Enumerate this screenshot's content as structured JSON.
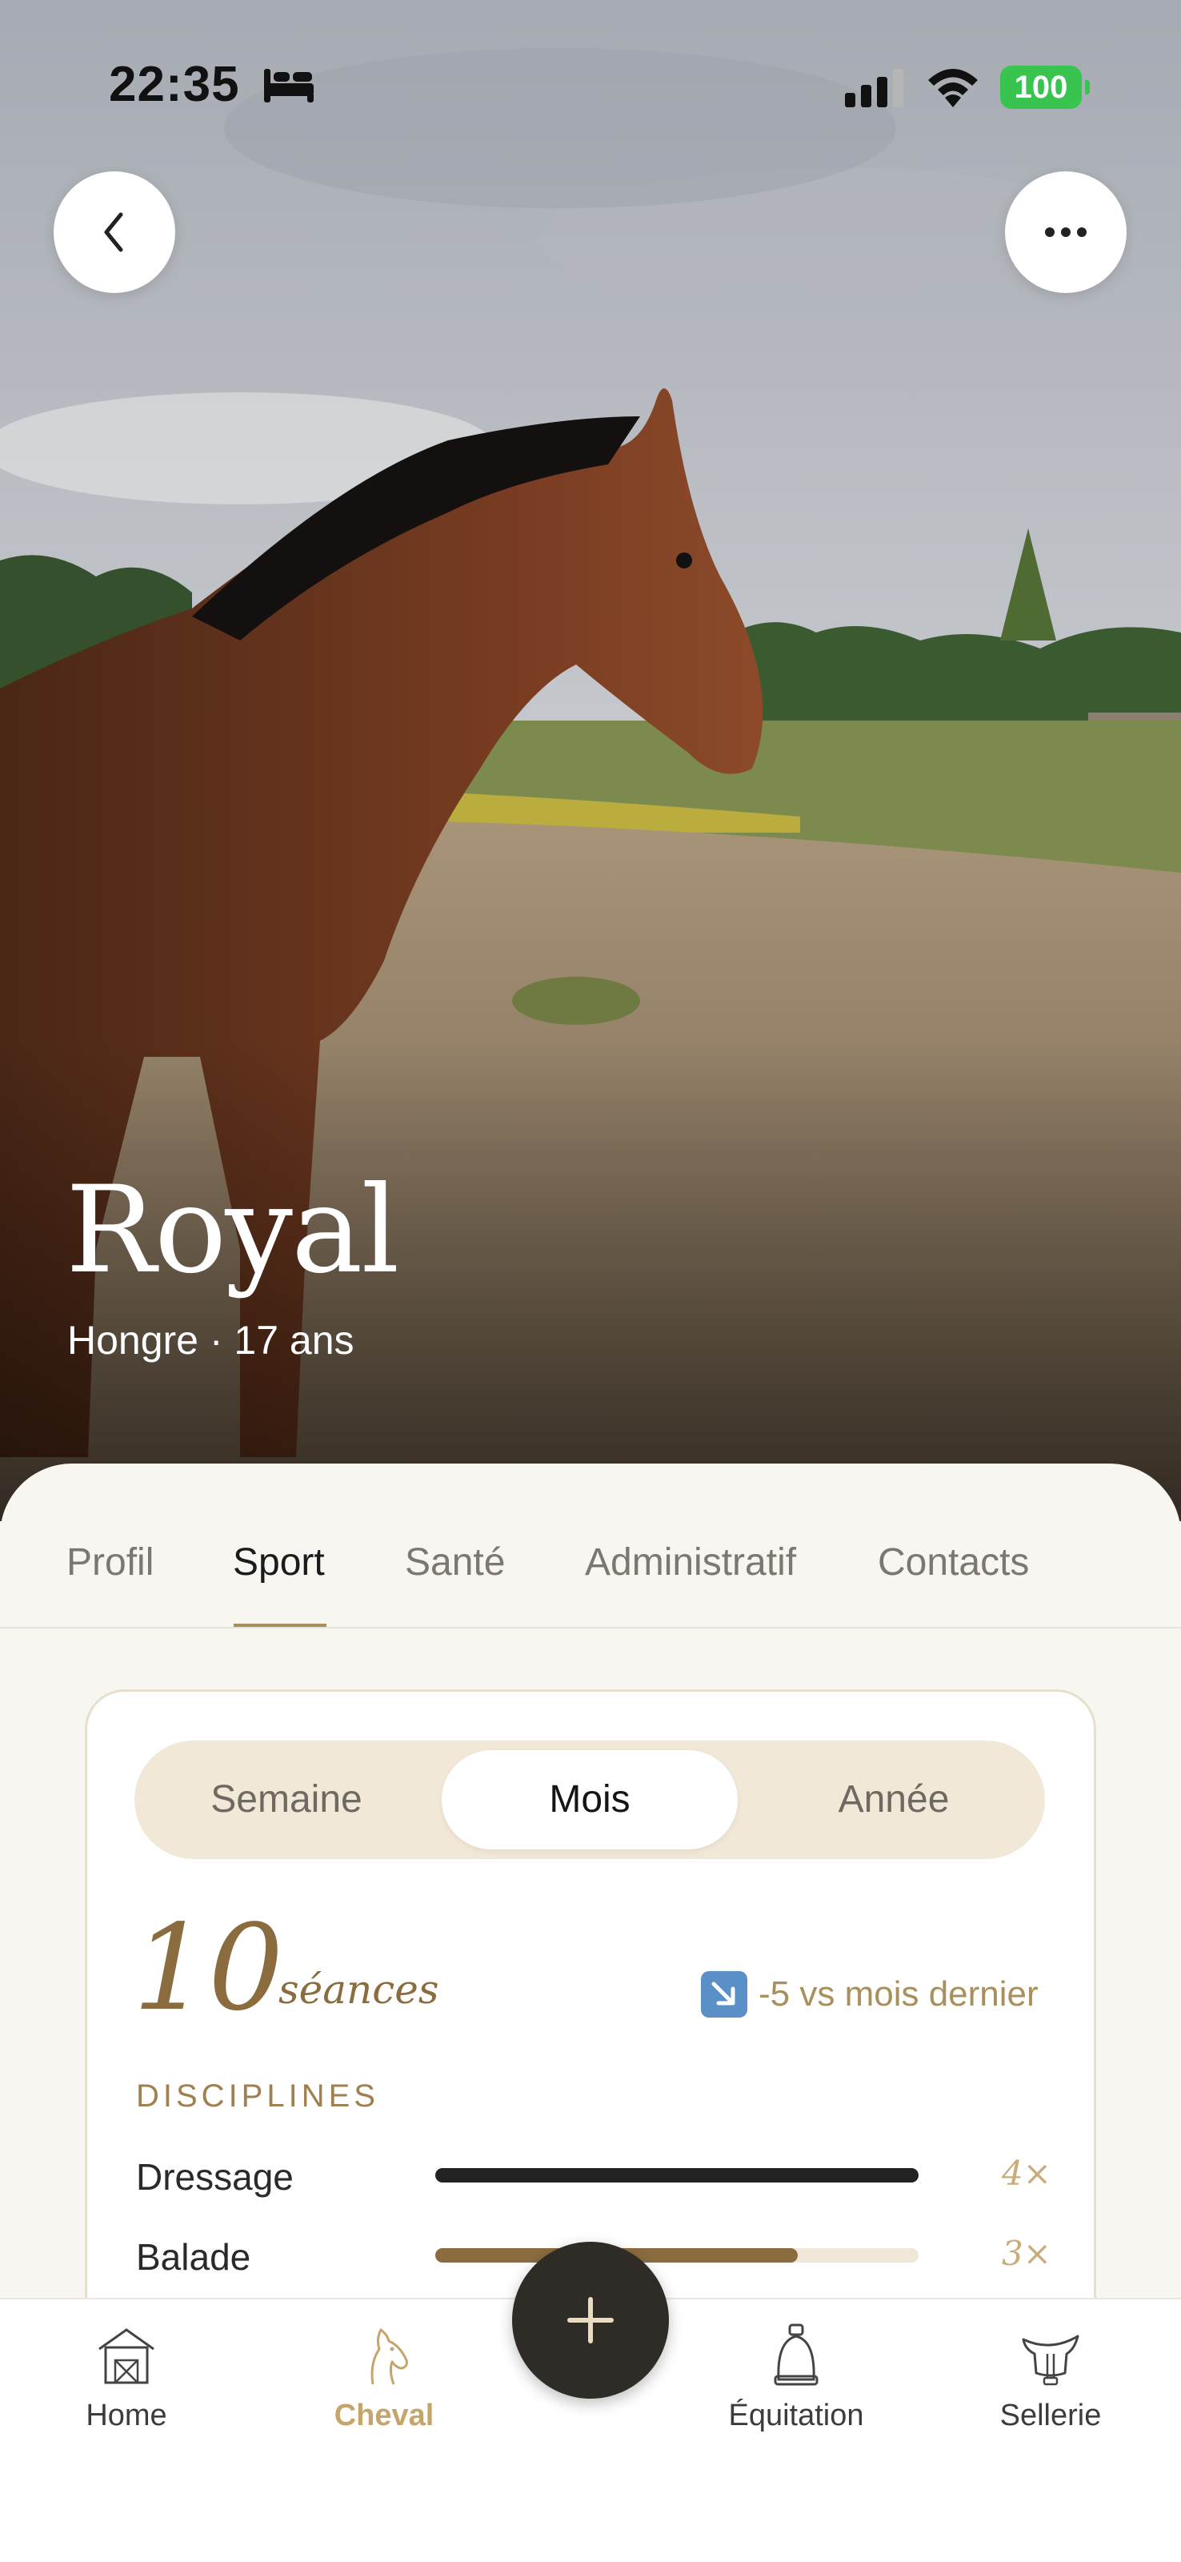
{
  "status_bar": {
    "time": "22:35",
    "battery": "100"
  },
  "horse": {
    "name": "Royal",
    "meta": "Hongre · 17 ans"
  },
  "tabs": [
    {
      "label": "Profil"
    },
    {
      "label": "Sport"
    },
    {
      "label": "Santé"
    },
    {
      "label": "Administratif"
    },
    {
      "label": "Contacts"
    }
  ],
  "active_tab": "Sport",
  "period": {
    "options": [
      "Semaine",
      "Mois",
      "Année"
    ],
    "selected": "Mois"
  },
  "stats": {
    "count": "10",
    "unit": "séances",
    "trend": "-5 vs mois dernier",
    "trend_icon": "arrow-down-right-icon"
  },
  "disciplines": {
    "label": "DISCIPLINES",
    "items": [
      {
        "name": "Dressage",
        "count": "4×",
        "value": 4,
        "color": "#222222"
      },
      {
        "name": "Balade",
        "count": "3×",
        "value": 3,
        "color": "#8a6c3f"
      }
    ],
    "max": 4
  },
  "bottom_nav": {
    "items": [
      {
        "label": "Home",
        "icon": "barn-icon"
      },
      {
        "label": "Cheval",
        "icon": "horse-head-icon"
      },
      {
        "label": "Équitation",
        "icon": "stirrup-icon"
      },
      {
        "label": "Sellerie",
        "icon": "saddle-icon"
      }
    ],
    "active": "Cheval",
    "fab_icon": "plus-icon"
  },
  "colors": {
    "accent": "#a8905e",
    "gold_text": "#8a6c3f",
    "dark": "#2f2c27",
    "segment_bg": "#f2e8d8",
    "battery": "#38c44f"
  }
}
